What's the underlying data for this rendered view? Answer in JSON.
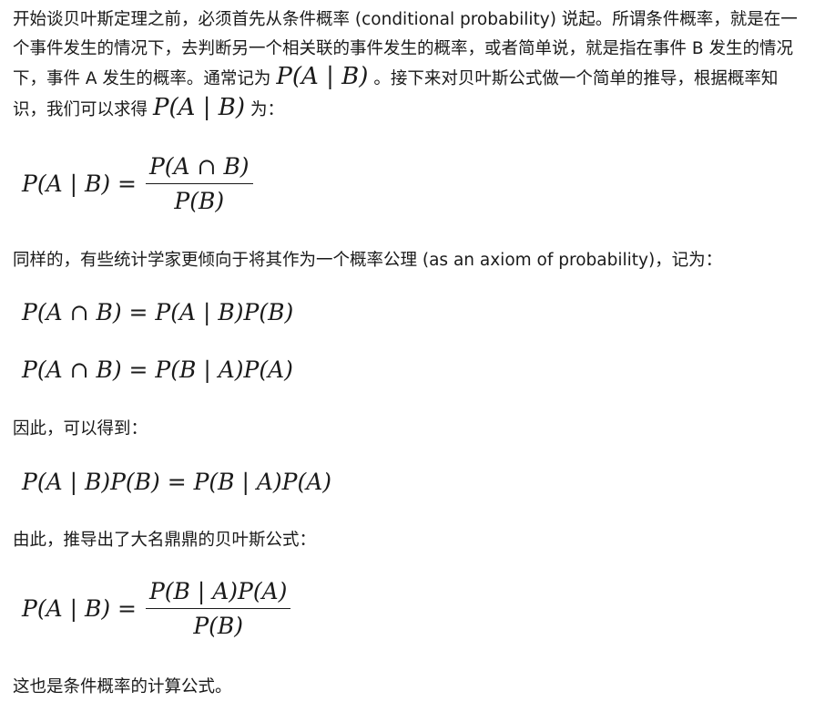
{
  "intro": {
    "part1": " 开始谈贝叶斯定理之前，必须首先从条件概率 (conditional probability) 说起。所谓条件概率，就是在一个事件发生的情况下，去判断另一个相关联的事件发生的概率，或者简单说，就是指在事件 B 发生的情况下，事件 A 发生的概率。通常记为",
    "math1": "P(A | B)",
    "part2": "。接下来对贝叶斯公式做一个简单的推导，根据概率知识，我们可以求得",
    "math2": "P(A | B)",
    "part3": "为："
  },
  "eq1": {
    "lhs": "P(A | B) =",
    "numerator": "P(A ∩ B)",
    "denominator": "P(B)"
  },
  "para2": "同样的，有些统计学家更倾向于将其作为一个概率公理 (as an axiom of probability)，记为：",
  "eq2": "P(A ∩ B) = P(A | B)P(B)",
  "eq3": "P(A ∩ B) = P(B | A)P(A)",
  "para3": "因此，可以得到：",
  "eq4": "P(A | B)P(B) = P(B | A)P(A)",
  "para4": "由此，推导出了大名鼎鼎的贝叶斯公式：",
  "eq5": {
    "lhs": "P(A | B) =",
    "numerator": "P(B | A)P(A)",
    "denominator": "P(B)"
  },
  "para5": "这也是条件概率的计算公式。"
}
